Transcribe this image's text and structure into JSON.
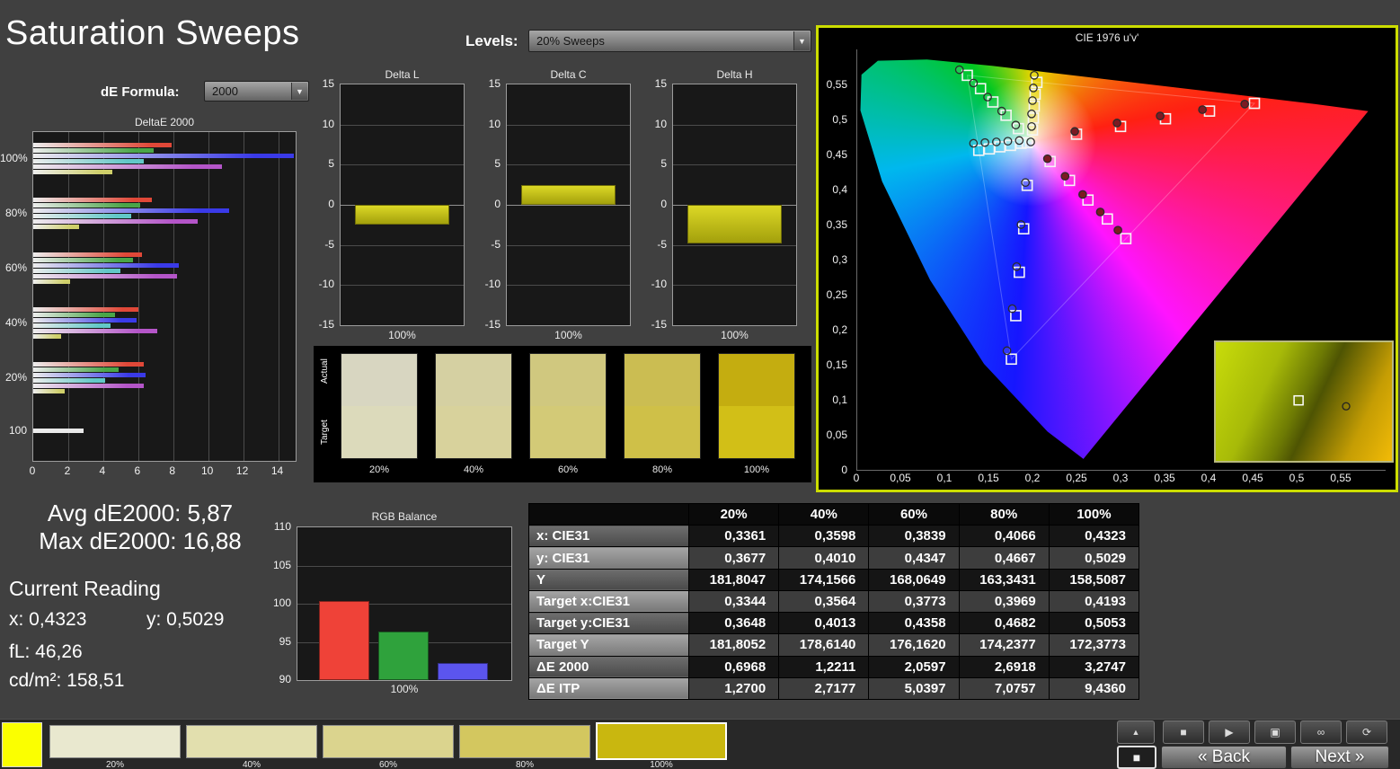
{
  "page": {
    "title": "Saturation Sweeps"
  },
  "controls": {
    "de_formula_label": "dE Formula:",
    "de_formula_value": "2000",
    "levels_label": "Levels:",
    "levels_value": "20% Sweeps",
    "dropdown_arrow": "▼"
  },
  "stats": {
    "avg": "Avg dE2000: 5,87",
    "max": "Max dE2000: 16,88",
    "current_reading_label": "Current Reading",
    "x": "x: 0,4323",
    "y": "y: 0,5029",
    "fl": "fL: 46,26",
    "cdm2": "cd/m²: 158,51"
  },
  "chart_data": [
    {
      "id": "deltae2000",
      "type": "bar",
      "orientation": "horizontal",
      "title": "DeltaE 2000",
      "xticks": [
        0,
        2,
        4,
        6,
        8,
        10,
        12,
        14
      ],
      "xmax": 15,
      "series_colors": {
        "red": "#e04838",
        "green": "#4aa548",
        "blue": "#3a3ae8",
        "cyan": "#62c8c8",
        "magenta": "#b455c8",
        "yellow": "#cfcf6a",
        "white": "#e8e8e8"
      },
      "groups": [
        {
          "label": "100%",
          "bars": [
            [
              "red",
              7.9
            ],
            [
              "green",
              6.9
            ],
            [
              "blue",
              14.9
            ],
            [
              "cyan",
              6.3
            ],
            [
              "magenta",
              10.8
            ],
            [
              "yellow",
              4.5
            ]
          ]
        },
        {
          "label": "80%",
          "bars": [
            [
              "red",
              6.8
            ],
            [
              "green",
              6.1
            ],
            [
              "blue",
              11.2
            ],
            [
              "cyan",
              5.6
            ],
            [
              "magenta",
              9.4
            ],
            [
              "yellow",
              2.6
            ]
          ]
        },
        {
          "label": "60%",
          "bars": [
            [
              "red",
              6.2
            ],
            [
              "green",
              5.7
            ],
            [
              "blue",
              8.3
            ],
            [
              "cyan",
              5.0
            ],
            [
              "magenta",
              8.2
            ],
            [
              "yellow",
              2.1
            ]
          ]
        },
        {
          "label": "40%",
          "bars": [
            [
              "red",
              6.0
            ],
            [
              "green",
              4.7
            ],
            [
              "blue",
              5.9
            ],
            [
              "cyan",
              4.4
            ],
            [
              "magenta",
              7.1
            ],
            [
              "yellow",
              1.6
            ]
          ]
        },
        {
          "label": "20%",
          "bars": [
            [
              "red",
              6.3
            ],
            [
              "green",
              4.9
            ],
            [
              "blue",
              6.4
            ],
            [
              "cyan",
              4.1
            ],
            [
              "magenta",
              6.3
            ],
            [
              "yellow",
              1.8
            ]
          ]
        },
        {
          "label": "100",
          "bars": [
            [
              "white",
              2.9
            ]
          ]
        }
      ]
    },
    {
      "id": "delta_l",
      "type": "bar",
      "title": "Delta L",
      "value": -2.5,
      "ylim": [
        -15,
        15
      ],
      "yticks": [
        15,
        10,
        5,
        0,
        -5,
        -10,
        -15
      ],
      "xlabel": "100%"
    },
    {
      "id": "delta_c",
      "type": "bar",
      "title": "Delta C",
      "value": 2.5,
      "ylim": [
        -15,
        15
      ],
      "yticks": [
        15,
        10,
        5,
        0,
        -5,
        -10,
        -15
      ],
      "xlabel": "100%"
    },
    {
      "id": "delta_h",
      "type": "bar",
      "title": "Delta H",
      "value": -4.8,
      "ylim": [
        -15,
        15
      ],
      "yticks": [
        15,
        10,
        5,
        0,
        -5,
        -10,
        -15
      ],
      "xlabel": "100%"
    },
    {
      "id": "rgb_balance",
      "type": "bar",
      "title": "RGB Balance",
      "categories": [
        "Red",
        "Green",
        "Blue"
      ],
      "values": [
        100.3,
        96.4,
        92.2
      ],
      "colors": [
        "#ef4238",
        "#2fa23c",
        "#5b55ee"
      ],
      "ylim": [
        90,
        110
      ],
      "yticks": [
        110,
        105,
        100,
        95,
        90
      ],
      "xlabel": "100%"
    },
    {
      "id": "cie",
      "type": "scatter",
      "title": "CIE 1976 u'v'",
      "xtick_labels": [
        "0",
        "0,05",
        "0,1",
        "0,15",
        "0,2",
        "0,25",
        "0,3",
        "0,35",
        "0,4",
        "0,45",
        "0,5",
        "0,55"
      ],
      "ytick_labels": [
        "0",
        "0,05",
        "0,1",
        "0,15",
        "0,2",
        "0,25",
        "0,3",
        "0,35",
        "0,4",
        "0,45",
        "0,5",
        "0,55"
      ],
      "primaries": [
        [
          0.451,
          0.523
        ],
        [
          0.125,
          0.563
        ],
        [
          0.175,
          0.158
        ]
      ],
      "white_point": [
        0.198,
        0.468
      ],
      "targets": [
        [
          0.249,
          0.479
        ],
        [
          0.299,
          0.49
        ],
        [
          0.35,
          0.501
        ],
        [
          0.4,
          0.512
        ],
        [
          0.451,
          0.523
        ],
        [
          0.183,
          0.487
        ],
        [
          0.169,
          0.506
        ],
        [
          0.154,
          0.525
        ],
        [
          0.14,
          0.544
        ],
        [
          0.125,
          0.563
        ],
        [
          0.193,
          0.406
        ],
        [
          0.189,
          0.344
        ],
        [
          0.184,
          0.282
        ],
        [
          0.18,
          0.22
        ],
        [
          0.175,
          0.158
        ],
        [
          0.186,
          0.466
        ],
        [
          0.174,
          0.463
        ],
        [
          0.162,
          0.461
        ],
        [
          0.15,
          0.458
        ],
        [
          0.138,
          0.456
        ],
        [
          0.219,
          0.44
        ],
        [
          0.241,
          0.413
        ],
        [
          0.262,
          0.385
        ],
        [
          0.284,
          0.358
        ],
        [
          0.305,
          0.33
        ],
        [
          0.199,
          0.485
        ],
        [
          0.2,
          0.502
        ],
        [
          0.201,
          0.519
        ],
        [
          0.202,
          0.536
        ],
        [
          0.204,
          0.553
        ],
        [
          0.193,
          0.467
        ]
      ],
      "measured": [
        [
          0.247,
          0.483,
          "r"
        ],
        [
          0.295,
          0.495,
          "r"
        ],
        [
          0.344,
          0.505,
          "r"
        ],
        [
          0.392,
          0.514,
          "r"
        ],
        [
          0.44,
          0.522,
          "r"
        ],
        [
          0.216,
          0.444,
          "r"
        ],
        [
          0.236,
          0.419,
          "r"
        ],
        [
          0.256,
          0.393,
          "r"
        ],
        [
          0.276,
          0.368,
          "r"
        ],
        [
          0.296,
          0.342,
          "r"
        ],
        [
          0.18,
          0.492
        ],
        [
          0.164,
          0.512
        ],
        [
          0.148,
          0.532
        ],
        [
          0.132,
          0.552
        ],
        [
          0.116,
          0.571
        ],
        [
          0.191,
          0.41
        ],
        [
          0.186,
          0.35
        ],
        [
          0.181,
          0.29
        ],
        [
          0.176,
          0.23
        ],
        [
          0.17,
          0.17
        ],
        [
          0.184,
          0.47
        ],
        [
          0.171,
          0.469
        ],
        [
          0.158,
          0.468
        ],
        [
          0.145,
          0.467
        ],
        [
          0.132,
          0.466
        ],
        [
          0.198,
          0.49
        ],
        [
          0.198,
          0.508
        ],
        [
          0.199,
          0.527
        ],
        [
          0.2,
          0.545
        ],
        [
          0.201,
          0.563
        ],
        [
          0.197,
          0.468
        ]
      ],
      "inset": {
        "square": [
          0.47,
          0.49
        ],
        "circle": [
          0.74,
          0.54
        ]
      }
    },
    {
      "id": "results_table",
      "type": "table",
      "columns": [
        "20%",
        "40%",
        "60%",
        "80%",
        "100%"
      ],
      "rows": [
        {
          "label": "x: CIE31",
          "values": [
            "0,3361",
            "0,3598",
            "0,3839",
            "0,4066",
            "0,4323"
          ]
        },
        {
          "label": "y: CIE31",
          "values": [
            "0,3677",
            "0,4010",
            "0,4347",
            "0,4667",
            "0,5029"
          ]
        },
        {
          "label": "Y",
          "values": [
            "181,8047",
            "174,1566",
            "168,0649",
            "163,3431",
            "158,5087"
          ]
        },
        {
          "label": "Target x:CIE31",
          "values": [
            "0,3344",
            "0,3564",
            "0,3773",
            "0,3969",
            "0,4193"
          ]
        },
        {
          "label": "Target y:CIE31",
          "values": [
            "0,3648",
            "0,4013",
            "0,4358",
            "0,4682",
            "0,5053"
          ]
        },
        {
          "label": "Target Y",
          "values": [
            "181,8052",
            "178,6140",
            "176,1620",
            "174,2377",
            "172,3773"
          ]
        },
        {
          "label": "ΔE 2000",
          "values": [
            "0,6968",
            "1,2211",
            "2,0597",
            "2,6918",
            "3,2747"
          ]
        },
        {
          "label": "ΔE ITP",
          "values": [
            "1,2700",
            "2,7177",
            "5,0397",
            "7,0757",
            "9,4360"
          ]
        }
      ]
    }
  ],
  "swatch_strip": {
    "row_labels": [
      "Actual",
      "Target"
    ],
    "items": [
      {
        "label": "20%",
        "actual": "#d8d6c1",
        "target": "#dcdabb"
      },
      {
        "label": "40%",
        "actual": "#d5d0a2",
        "target": "#d8d29c"
      },
      {
        "label": "60%",
        "actual": "#d0c87f",
        "target": "#d3ca77"
      },
      {
        "label": "80%",
        "actual": "#cbbd52",
        "target": "#cfc048"
      },
      {
        "label": "100%",
        "actual": "#c4ad10",
        "target": "#d2bf17"
      }
    ]
  },
  "bottom_bar": {
    "current_patch_color": "#fbff00",
    "items": [
      {
        "label": "20%",
        "color": "#e9e8cf"
      },
      {
        "label": "40%",
        "color": "#e2dfae"
      },
      {
        "label": "60%",
        "color": "#dbd48e"
      },
      {
        "label": "80%",
        "color": "#d3c75f"
      },
      {
        "label": "100%",
        "color": "#c9b70f",
        "active": true
      }
    ]
  },
  "transport": {
    "eject_icon": "▲",
    "stop_icon": "■",
    "back_label": "« Back",
    "next_label": "Next »",
    "buttons": [
      {
        "name": "stop-small-button",
        "icon": "■"
      },
      {
        "name": "play-button",
        "icon": "▶"
      },
      {
        "name": "meter-button",
        "icon": "▣"
      },
      {
        "name": "continuous-button",
        "icon": "∞"
      },
      {
        "name": "loop-button",
        "icon": "⟳"
      }
    ]
  }
}
